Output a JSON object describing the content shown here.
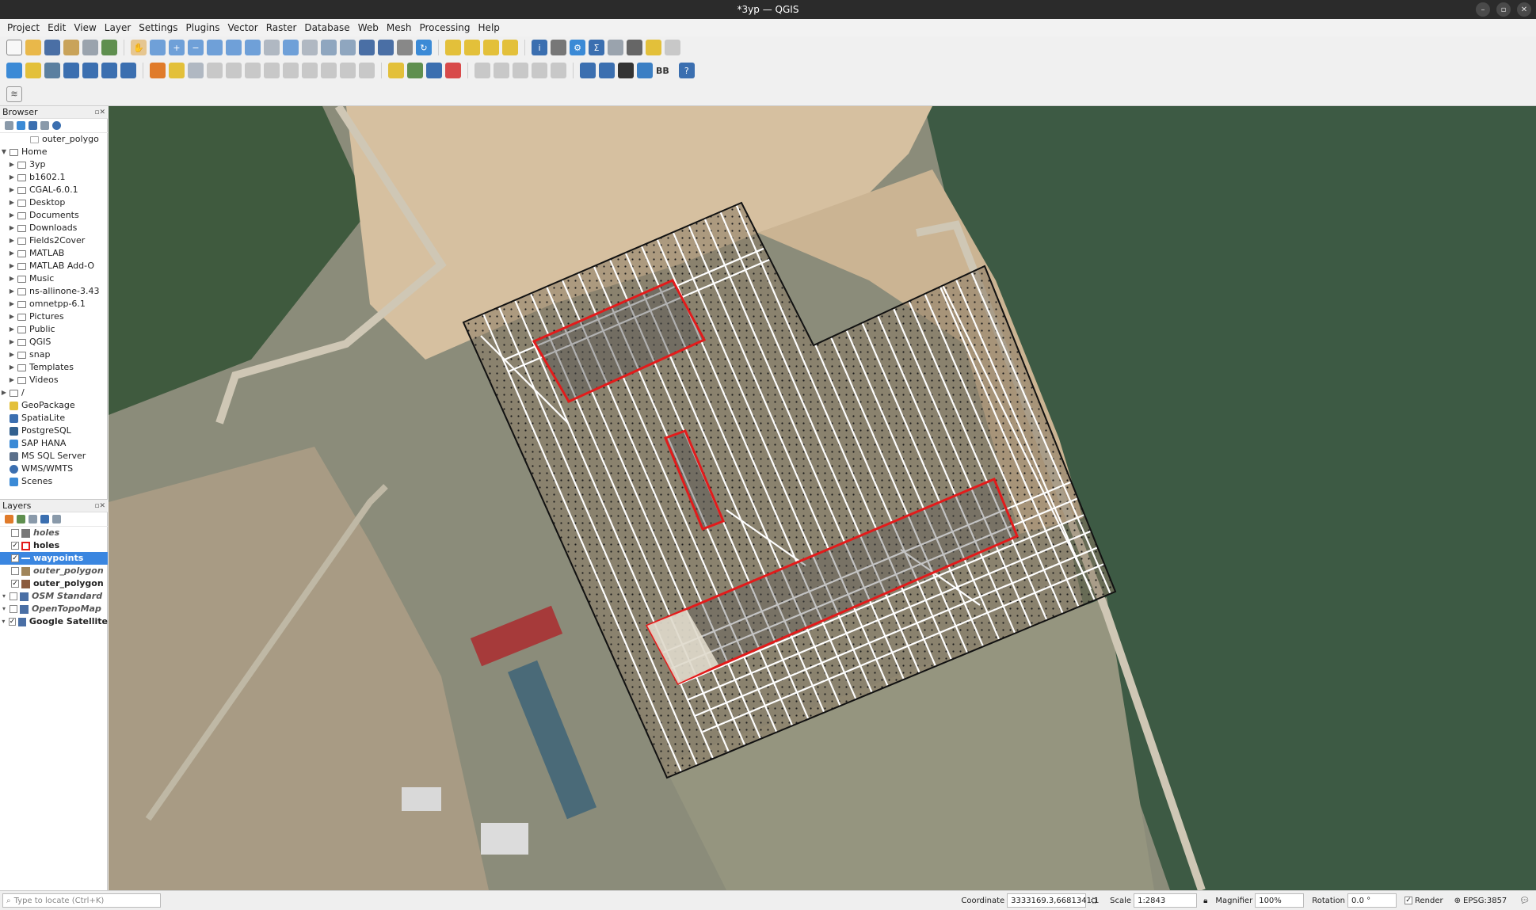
{
  "window": {
    "title": "*3yp — QGIS",
    "controls": [
      "–",
      "▫",
      "✕"
    ]
  },
  "menu": [
    "Project",
    "Edit",
    "View",
    "Layer",
    "Settings",
    "Plugins",
    "Vector",
    "Raster",
    "Database",
    "Web",
    "Mesh",
    "Processing",
    "Help"
  ],
  "toolbar": {
    "bb_label": "BB"
  },
  "browser": {
    "title": "Browser",
    "scrolled_item": "outer_polygo",
    "home_label": "Home",
    "folders": [
      "3yp",
      "b1602.1",
      "CGAL-6.0.1",
      "Desktop",
      "Documents",
      "Downloads",
      "Fields2Cover",
      "MATLAB",
      "MATLAB Add-O",
      "Music",
      "ns-allinone-3.43",
      "omnetpp-6.1",
      "Pictures",
      "Public",
      "QGIS",
      "snap",
      "Templates",
      "Videos"
    ],
    "root_label": "/",
    "providers": [
      "GeoPackage",
      "SpatiaLite",
      "PostgreSQL",
      "SAP HANA",
      "MS SQL Server",
      "WMS/WMTS",
      "Scenes"
    ]
  },
  "layers": {
    "title": "Layers",
    "items": [
      {
        "name": "holes",
        "checked": false,
        "selected": false,
        "dim": true
      },
      {
        "name": "holes",
        "checked": true,
        "selected": false,
        "dim": false
      },
      {
        "name": "waypoints",
        "checked": true,
        "selected": true,
        "dim": false
      },
      {
        "name": "outer_polygon",
        "checked": false,
        "selected": false,
        "dim": true
      },
      {
        "name": "outer_polygon",
        "checked": true,
        "selected": false,
        "dim": false
      },
      {
        "name": "OSM Standard",
        "checked": false,
        "selected": false,
        "dim": true
      },
      {
        "name": "OpenTopoMap",
        "checked": false,
        "selected": false,
        "dim": true
      },
      {
        "name": "Google Satellite",
        "checked": true,
        "selected": false,
        "dim": false
      }
    ]
  },
  "status": {
    "locate_placeholder": "Type to locate (Ctrl+K)",
    "coordinate_label": "Coordinate",
    "coordinate_value": "3333169.3,6681341.1",
    "scale_label": "Scale",
    "scale_value": "1:2843",
    "magnifier_label": "Magnifier",
    "magnifier_value": "100%",
    "rotation_label": "Rotation",
    "rotation_value": "0.0 °",
    "render_label": "Render",
    "crs": "EPSG:3857"
  },
  "colors": {
    "hole_outline": "#e21b1b",
    "sweep_lines": "#ffffff",
    "selection": "#3a86e0"
  }
}
